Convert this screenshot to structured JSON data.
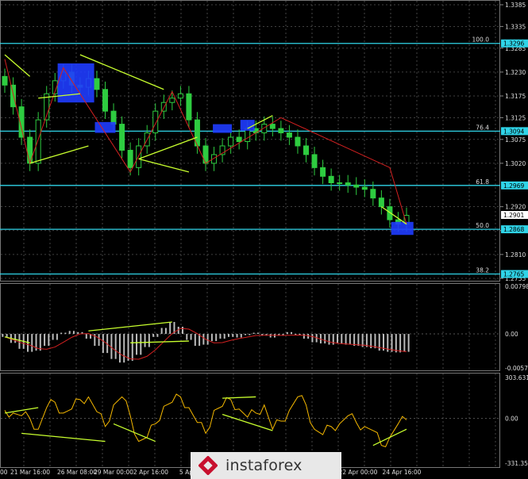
{
  "chart_data": [
    {
      "type": "candlestick",
      "instrument_panel": "main",
      "price_ticks": [
        "1.3385",
        "1.3335",
        "1.3285",
        "1.3230",
        "1.3175",
        "1.3125",
        "1.3075",
        "1.3020",
        "1.2920",
        "1.2865",
        "1.2810",
        "1.2755"
      ],
      "ylim": [
        1.2755,
        1.3385
      ],
      "current_price": "1.2901",
      "levels": [
        {
          "fib": "100.0",
          "price": "1.3296"
        },
        {
          "fib": "76.4",
          "price": "1.3094"
        },
        {
          "fib": "61.8",
          "price": "1.2969"
        },
        {
          "fib": "50.0",
          "price": "1.2868"
        },
        {
          "fib": "38.2",
          "price": "1.2765"
        }
      ],
      "close": [
        1.32,
        1.315,
        1.308,
        1.302,
        1.312,
        1.318,
        1.321,
        1.323,
        1.32,
        1.3195,
        1.3215,
        1.319,
        1.314,
        1.311,
        1.305,
        1.301,
        1.306,
        1.309,
        1.314,
        1.316,
        1.317,
        1.318,
        1.312,
        1.306,
        1.302,
        1.304,
        1.306,
        1.308,
        1.307,
        1.31,
        1.309,
        1.311,
        1.31,
        1.309,
        1.308,
        1.306,
        1.304,
        1.301,
        1.299,
        1.2975,
        1.2975,
        1.297,
        1.2965,
        1.296,
        1.294,
        1.292,
        1.289,
        1.288,
        1.29
      ]
    },
    {
      "type": "histogram",
      "indicator_panel": "macd",
      "ticks": [
        "0.00798",
        "0.00",
        "-0.00571"
      ],
      "ylim": [
        -0.00571,
        0.00798
      ],
      "values": [
        -0.0005,
        -0.0015,
        -0.0025,
        -0.003,
        -0.0028,
        -0.002,
        -0.001,
        0.0002,
        0.0005,
        0.0003,
        -0.0008,
        -0.002,
        -0.0032,
        -0.0042,
        -0.0048,
        -0.0045,
        -0.0035,
        -0.0022,
        -0.0005,
        0.001,
        0.002,
        0.0012,
        -0.001,
        -0.002,
        -0.0018,
        -0.0012,
        -0.0008,
        -0.0005,
        -0.0006,
        -0.0002,
        0.0002,
        -0.0003,
        -0.0006,
        -0.0003,
        0.0003,
        -0.0002,
        -0.0008,
        -0.0014,
        -0.0016,
        -0.0018,
        -0.0016,
        -0.0018,
        -0.002,
        -0.0022,
        -0.0024,
        -0.0028,
        -0.003,
        -0.0031,
        -0.003
      ]
    },
    {
      "type": "line",
      "indicator_panel": "cci",
      "ticks": [
        "303.6317",
        "0.00",
        "-331.359"
      ],
      "ylim": [
        -331.359,
        303.6317
      ],
      "values": [
        60,
        40,
        20,
        0,
        -80,
        80,
        120,
        40,
        70,
        140,
        160,
        50,
        -60,
        100,
        160,
        20,
        -170,
        -140,
        -40,
        90,
        120,
        160,
        80,
        -30,
        -110,
        60,
        90,
        140,
        70,
        10,
        40,
        100,
        -80,
        -20,
        60,
        160,
        100,
        -80,
        -120,
        -60,
        -40,
        20,
        -30,
        -60,
        -90,
        -200,
        -140,
        -40,
        -10
      ]
    },
    {
      "type": "table",
      "time_axis": [
        "00",
        "21 Mar 16:00",
        "26 Mar 08:00",
        "29 Mar 00:00",
        "2 Apr 16:00",
        "5 Apr",
        "22 Apr 00:00",
        "24 Apr 16:00"
      ]
    }
  ],
  "watermark": {
    "text": "instaforex",
    "logo": "instaforex-logo-icon"
  }
}
